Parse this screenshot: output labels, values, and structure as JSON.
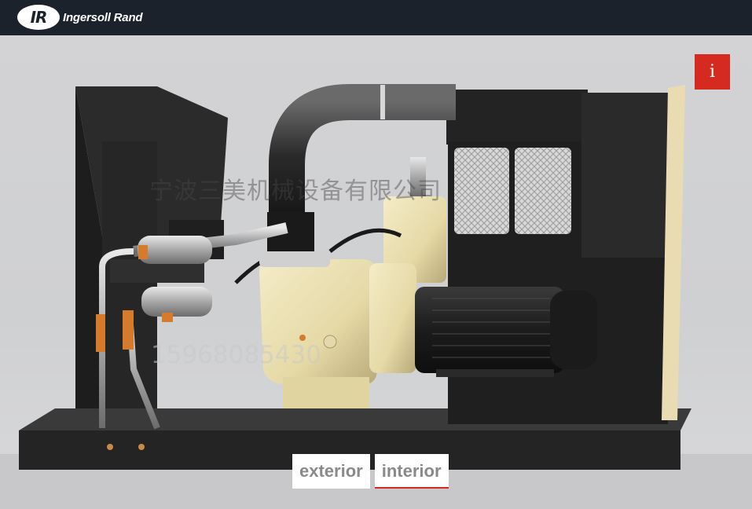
{
  "header": {
    "logo_mark": "IR",
    "brand": "Ingersoll Rand"
  },
  "info_button": {
    "label": "i"
  },
  "watermarks": {
    "company": "宁波三美机械设备有限公司",
    "phone": "15968085430"
  },
  "view_tabs": [
    {
      "label": "exterior",
      "active": false
    },
    {
      "label": "interior",
      "active": true
    }
  ],
  "colors": {
    "header_bg": "#1b222b",
    "accent_red": "#d42a1f",
    "machine_cream": "#e8ddb0",
    "frame_black": "#262626"
  }
}
